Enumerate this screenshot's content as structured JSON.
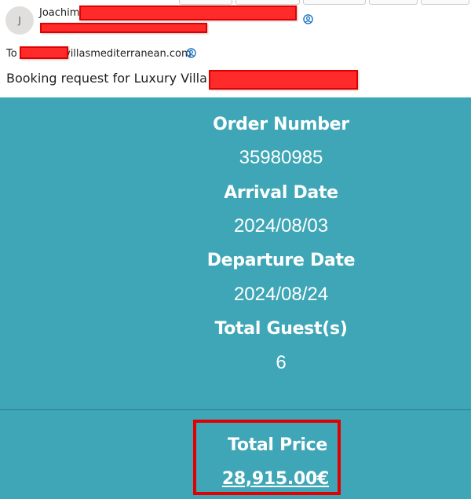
{
  "header": {
    "avatar_initial": "J",
    "sender_name": "Joachim",
    "to_label": "To",
    "to_domain": "villasmediterranean.com",
    "subject": "Booking request for Luxury Villa"
  },
  "booking": {
    "order_label": "Order Number",
    "order_value": "35980985",
    "arrival_label": "Arrival Date",
    "arrival_value": "2024/08/03",
    "departure_label": "Departure Date",
    "departure_value": "2024/08/24",
    "guests_label": "Total Guest(s)",
    "guests_value": "6",
    "price_label": "Total Price",
    "price_value": "28,915.00€"
  },
  "colors": {
    "body_background": "#3ea6b6",
    "highlight_box": "#e10000",
    "redaction": "#ff2a2a",
    "contact_icon": "#0f6cbd"
  },
  "icons": {
    "sender_contact": "contact-card-icon",
    "recipient_contact": "contact-card-icon"
  }
}
